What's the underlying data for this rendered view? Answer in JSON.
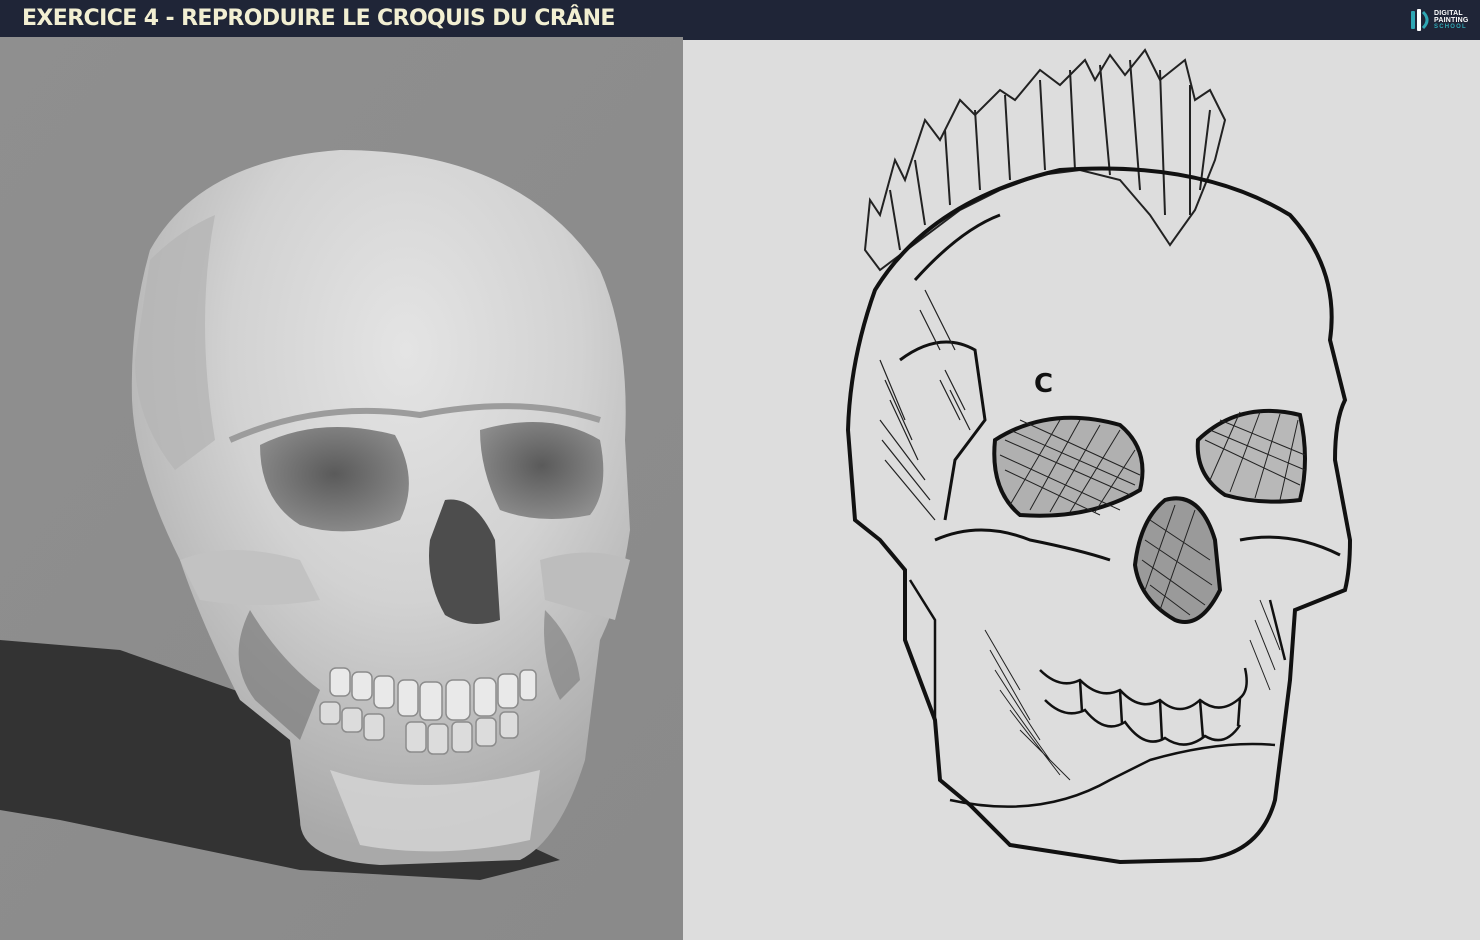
{
  "header": {
    "title": "EXERCICE 4 - REPRODUIRE LE CROQUIS DU CRÂNE",
    "logo": {
      "icon": "digital-painting-school-logo",
      "line1": "DIGITAL",
      "line2": "PAINTING",
      "line3": "SCHOOL",
      "accent_color": "#2fa7b4"
    }
  },
  "reference_panel": {
    "image": "skull-render-photo",
    "background_color": "#8a8a8a"
  },
  "sketch_panel": {
    "image": "skull-mohawk-line-sketch",
    "background_color": "#dddddd",
    "forehead_glyph": "C"
  },
  "colors": {
    "header_bg": "#1f2537",
    "title_color": "#f2efd2"
  }
}
